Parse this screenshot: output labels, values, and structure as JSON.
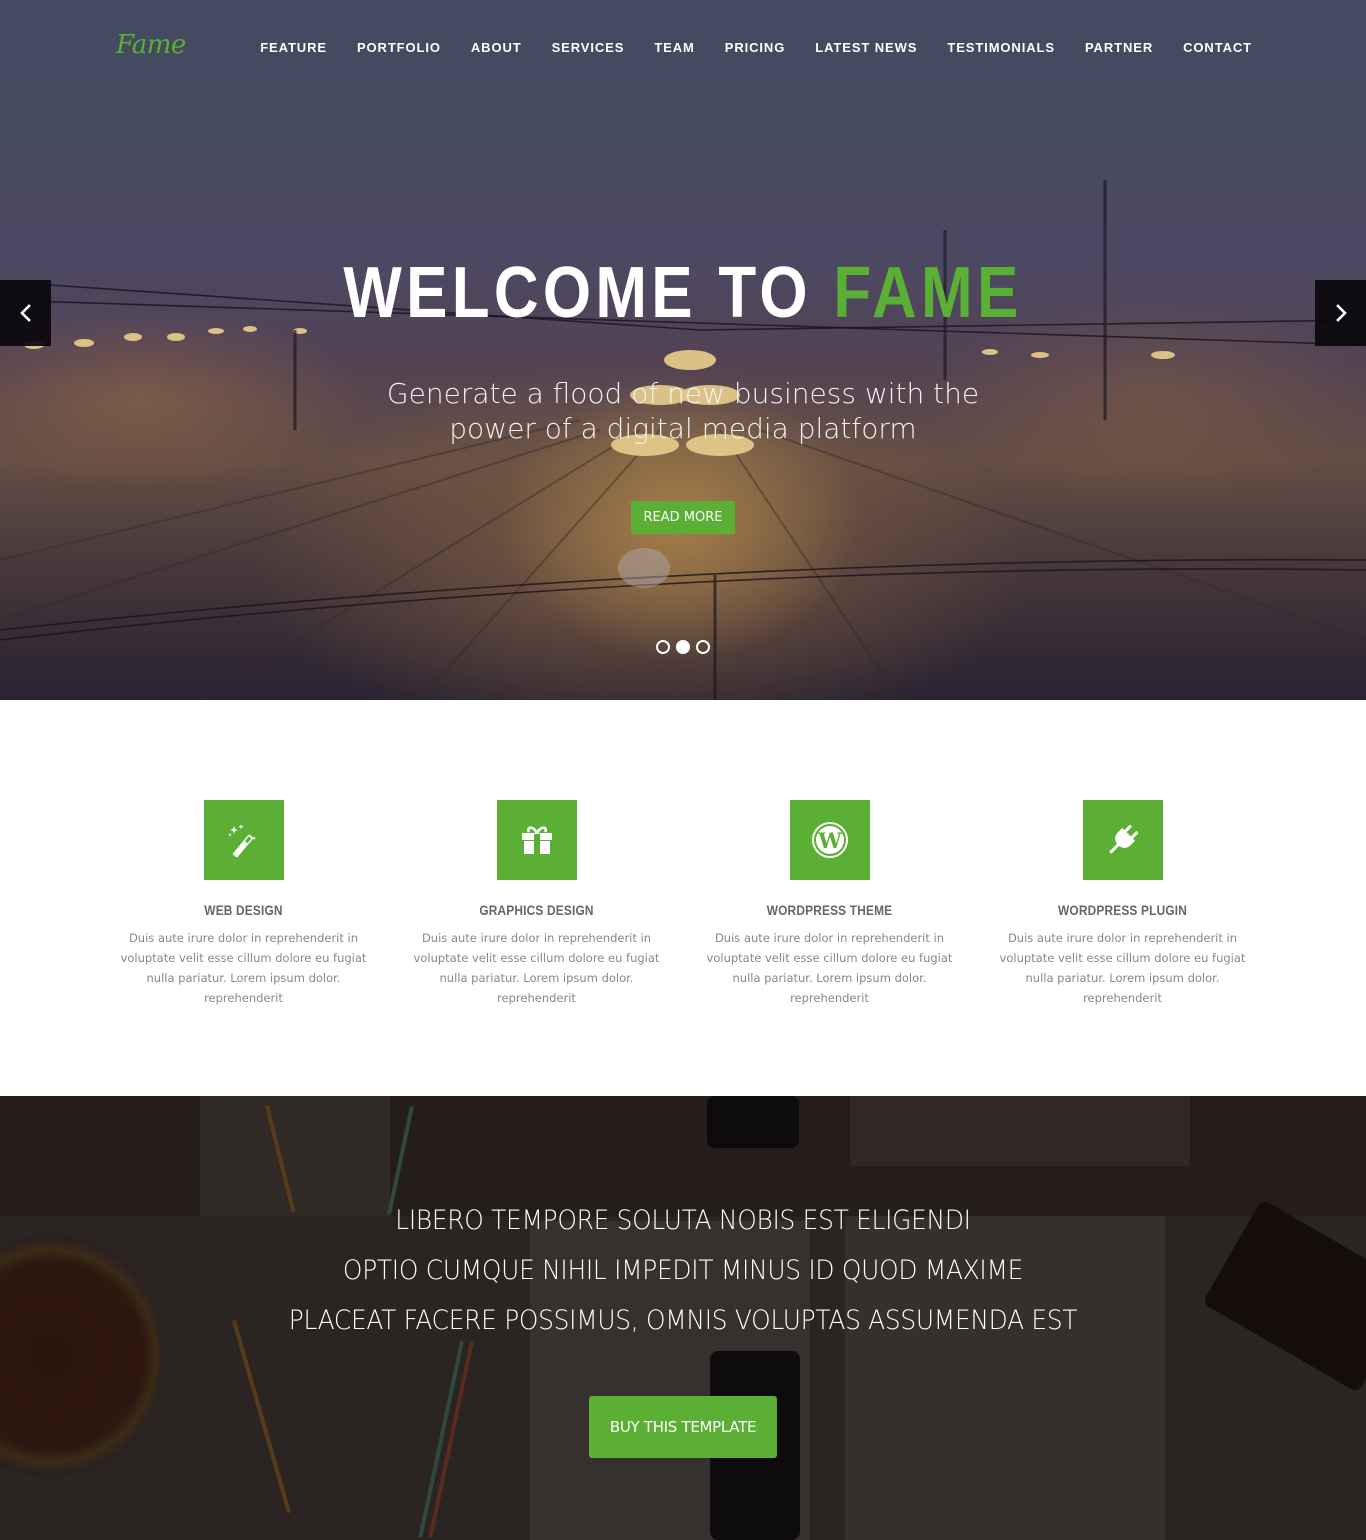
{
  "brand": {
    "logo_text": "Fame",
    "accent_color": "#5aaf34"
  },
  "nav": {
    "items": [
      {
        "label": "FEATURE"
      },
      {
        "label": "PORTFOLIO"
      },
      {
        "label": "ABOUT"
      },
      {
        "label": "SERVICES"
      },
      {
        "label": "TEAM"
      },
      {
        "label": "PRICING"
      },
      {
        "label": "LATEST NEWS"
      },
      {
        "label": "TESTIMONIALS"
      },
      {
        "label": "PARTNER"
      },
      {
        "label": "CONTACT"
      }
    ]
  },
  "hero": {
    "title_main": "WELCOME TO ",
    "title_accent": "FAME",
    "subtitle_line1": "Generate a flood of new business with the",
    "subtitle_line2": "power of a digital media platform",
    "button_label": "READ MORE",
    "prev_icon": "chevron-left-icon",
    "next_icon": "chevron-right-icon",
    "slides_total": 3,
    "active_slide": 2
  },
  "features": [
    {
      "icon": "magic-wand-icon",
      "title": "WEB DESIGN",
      "text": "Duis aute irure dolor in reprehenderit in voluptate velit esse cillum dolore eu fugiat nulla pariatur. Lorem ipsum dolor. reprehenderit"
    },
    {
      "icon": "gift-icon",
      "title": "GRAPHICS DESIGN",
      "text": "Duis aute irure dolor in reprehenderit in voluptate velit esse cillum dolore eu fugiat nulla pariatur. Lorem ipsum dolor. reprehenderit"
    },
    {
      "icon": "wordpress-icon",
      "title": "WORDPRESS THEME",
      "text": "Duis aute irure dolor in reprehenderit in voluptate velit esse cillum dolore eu fugiat nulla pariatur. Lorem ipsum dolor. reprehenderit"
    },
    {
      "icon": "plug-icon",
      "title": "WORDPRESS PLUGIN",
      "text": "Duis aute irure dolor in reprehenderit in voluptate velit esse cillum dolore eu fugiat nulla pariatur. Lorem ipsum dolor. reprehenderit"
    }
  ],
  "cta": {
    "lines": [
      "LIBERO TEMPORE SOLUTA NOBIS EST ELIGENDI",
      "OPTIO CUMQUE NIHIL IMPEDIT MINUS ID QUOD MAXIME",
      "PLACEAT FACERE POSSIMUS, OMNIS VOLUPTAS ASSUMENDA EST"
    ],
    "button_label": "BUY THIS TEMPLATE"
  }
}
